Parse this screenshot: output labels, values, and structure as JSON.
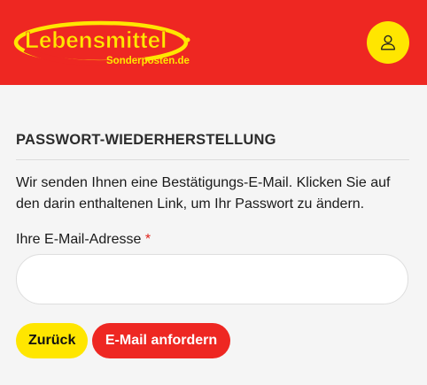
{
  "colors": {
    "brand_red": "#ee2722",
    "brand_yellow": "#ffe600",
    "required": "#e0231c"
  },
  "header": {
    "logo": {
      "name": "Lebensmittel",
      "subtitle": "Sonderposten.de"
    },
    "account_icon": "user-icon"
  },
  "main": {
    "title": "PASSWORT-WIEDERHERSTELLUNG",
    "intro": "Wir senden Ihnen eine Bestätigungs-E-Mail. Klicken Sie auf den darin enthaltenen Link, um Ihr Passwort zu ändern.",
    "email_label": "Ihre E-Mail-Adresse",
    "required_marker": "*",
    "email_value": "",
    "email_placeholder": ""
  },
  "actions": {
    "back_label": "Zurück",
    "submit_label": "E-Mail anfordern"
  }
}
